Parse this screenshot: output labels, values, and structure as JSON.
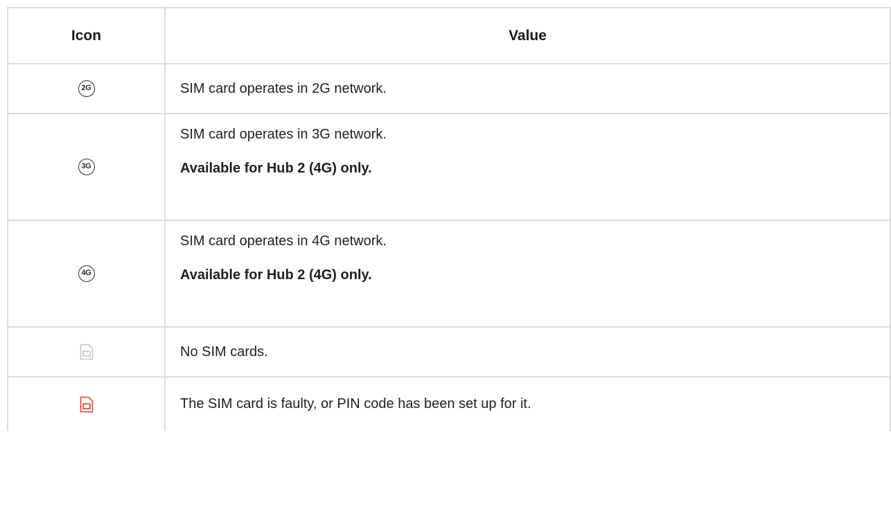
{
  "table": {
    "headers": {
      "icon": "Icon",
      "value": "Value"
    },
    "rows": [
      {
        "icon": "2g-network-icon",
        "icon_label": "2G",
        "text": "SIM card operates in 2G network.",
        "note": ""
      },
      {
        "icon": "3g-network-icon",
        "icon_label": "3G",
        "text": "SIM card operates in 3G network.",
        "note": "Available for Hub 2 (4G) only."
      },
      {
        "icon": "4g-network-icon",
        "icon_label": "4G",
        "text": "SIM card operates in 4G network.",
        "note": "Available for Hub 2 (4G) only."
      },
      {
        "icon": "no-sim-icon",
        "icon_label": "",
        "text": "No SIM cards.",
        "note": ""
      },
      {
        "icon": "faulty-sim-icon",
        "icon_label": "",
        "text": "The SIM card is faulty, or PIN code has been set up for it.",
        "note": ""
      }
    ]
  },
  "colors": {
    "border": "#dcdcdc",
    "text": "#1f1f1f",
    "no_sim_icon": "#c4c4c4",
    "faulty_sim_icon": "#e5533d"
  }
}
